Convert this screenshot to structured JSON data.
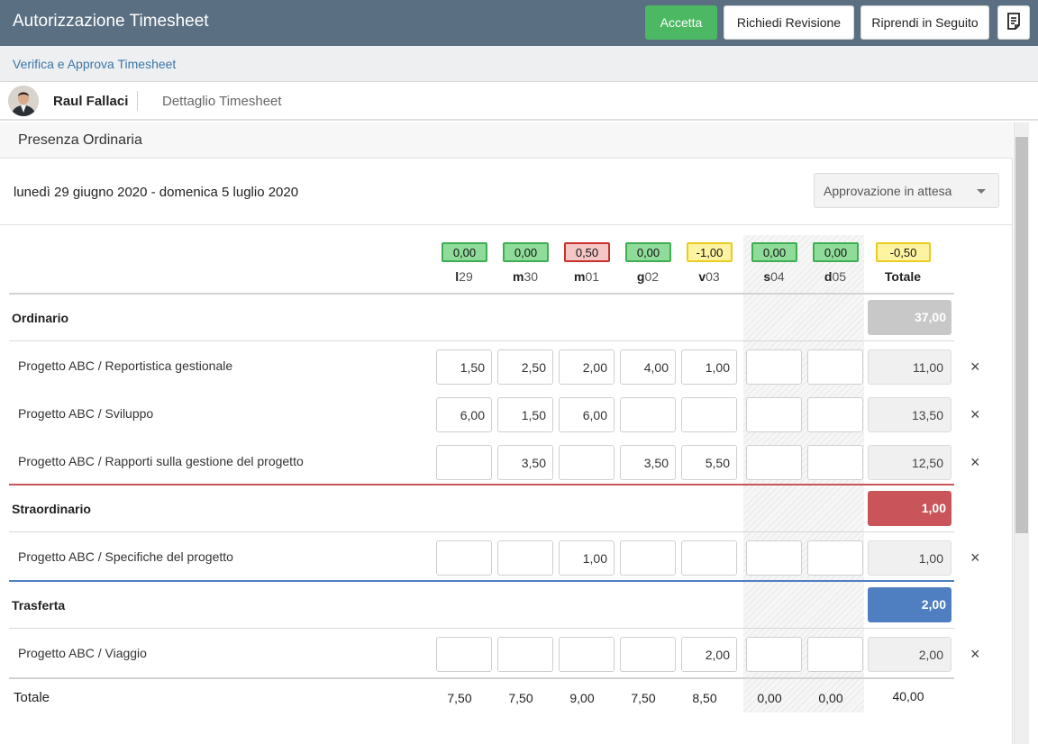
{
  "header": {
    "title": "Autorizzazione Timesheet",
    "accept_label": "Accetta",
    "review_label": "Richiedi Revisione",
    "later_label": "Riprendi in Seguito",
    "doc_icon": "document-icon"
  },
  "breadcrumb": {
    "link": "Verifica e Approva Timesheet"
  },
  "user": {
    "name": "Raul Fallaci",
    "tab": "Dettaglio Timesheet"
  },
  "section": {
    "title": "Presenza Ordinaria",
    "period": "lunedì 29 giugno 2020 - domenica 5 luglio 2020",
    "status": "Approvazione in attesa"
  },
  "days": [
    {
      "letter": "l",
      "num": "29",
      "balance": "0,00",
      "status": "green",
      "total": "7,50"
    },
    {
      "letter": "m",
      "num": "30",
      "balance": "0,00",
      "status": "green",
      "total": "7,50"
    },
    {
      "letter": "m",
      "num": "01",
      "balance": "0,50",
      "status": "red",
      "total": "9,00"
    },
    {
      "letter": "g",
      "num": "02",
      "balance": "0,00",
      "status": "green",
      "total": "7,50"
    },
    {
      "letter": "v",
      "num": "03",
      "balance": "-1,00",
      "status": "yellow",
      "total": "8,50"
    },
    {
      "letter": "s",
      "num": "04",
      "balance": "0,00",
      "status": "green",
      "total": "0,00"
    },
    {
      "letter": "d",
      "num": "05",
      "balance": "0,00",
      "status": "green",
      "total": "0,00"
    }
  ],
  "total_column": {
    "label": "Totale",
    "balance": "-0,50",
    "status": "yellow"
  },
  "categories": [
    {
      "name": "Ordinario",
      "total": "37,00",
      "color": "#c8c8c8",
      "rows": [
        {
          "project": "Progetto ABC / Reportistica gestionale",
          "values": [
            "1,50",
            "2,50",
            "2,00",
            "4,00",
            "1,00",
            "",
            ""
          ],
          "total": "11,00"
        },
        {
          "project": "Progetto ABC / Sviluppo",
          "values": [
            "6,00",
            "1,50",
            "6,00",
            "",
            "",
            "",
            ""
          ],
          "total": "13,50"
        },
        {
          "project": "Progetto ABC / Rapporti sulla gestione del progetto",
          "values": [
            "",
            "3,50",
            "",
            "3,50",
            "5,50",
            "",
            ""
          ],
          "total": "12,50"
        }
      ]
    },
    {
      "name": "Straordinario",
      "total": "1,00",
      "color": "#c9555a",
      "rows": [
        {
          "project": "Progetto ABC / Specifiche del progetto",
          "values": [
            "",
            "",
            "1,00",
            "",
            "",
            "",
            ""
          ],
          "total": "1,00"
        }
      ]
    },
    {
      "name": "Trasferta",
      "total": "2,00",
      "color": "#4f7fc1",
      "rows": [
        {
          "project": "Progetto ABC / Viaggio",
          "values": [
            "",
            "",
            "",
            "",
            "2,00",
            "",
            ""
          ],
          "total": "2,00"
        }
      ]
    }
  ],
  "footer": {
    "label": "Totale",
    "grand_total": "40,00"
  },
  "delete_glyph": "×"
}
